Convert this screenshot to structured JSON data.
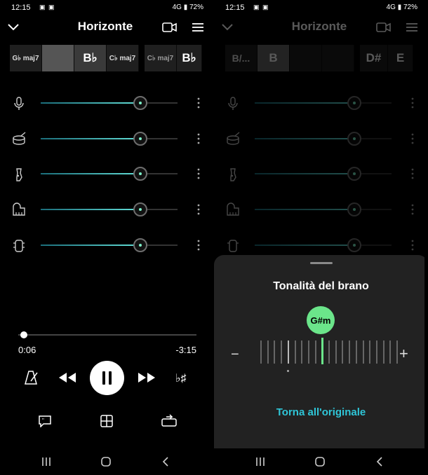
{
  "status": {
    "time": "12:15",
    "network": "4G",
    "battery": "72%"
  },
  "header": {
    "title": "Horizonte"
  },
  "left": {
    "chords": [
      "G♭ maj7",
      "",
      "B♭",
      "C♭ maj7",
      "C♭ maj7",
      "B♭"
    ],
    "tracks": [
      {
        "name": "microphone-icon",
        "level": 0.73
      },
      {
        "name": "drum-icon",
        "level": 0.73
      },
      {
        "name": "guitar-icon",
        "level": 0.73
      },
      {
        "name": "piano-icon",
        "level": 0.73
      },
      {
        "name": "bass-icon",
        "level": 0.73
      }
    ],
    "player": {
      "current_time": "0:06",
      "remaining_time": "-3:15",
      "progress": 0.03,
      "key_label": "♭♯"
    }
  },
  "right": {
    "chords": [
      "B/...",
      "B",
      "",
      "",
      "D#",
      "E"
    ],
    "sheet": {
      "title": "Tonalità del brano",
      "key": "G#m",
      "minus": "−",
      "plus": "+",
      "reset_label": "Torna all'originale"
    }
  },
  "colors": {
    "accent_teal": "#2fc6d8",
    "key_green": "#6be58a",
    "slider_gradient_end": "#63e0d8"
  }
}
